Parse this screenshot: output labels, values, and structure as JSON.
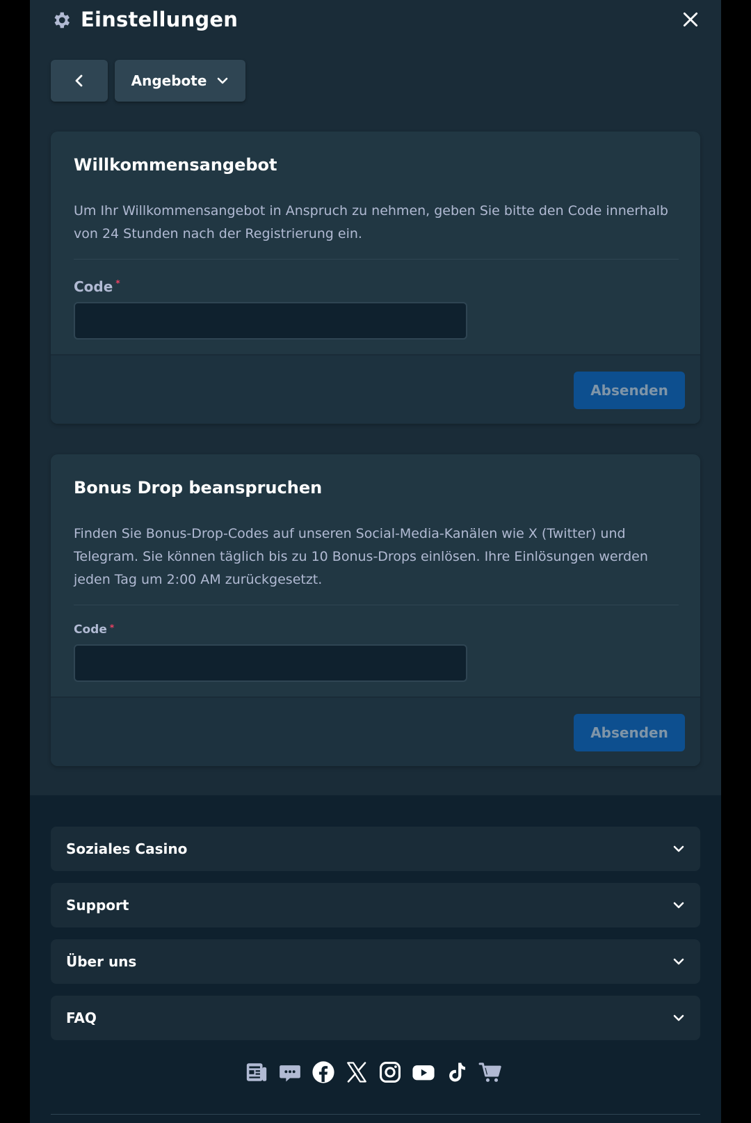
{
  "header": {
    "title": "Einstellungen"
  },
  "nav": {
    "dropdown_label": "Angebote"
  },
  "welcome": {
    "title": "Willkommensangebot",
    "description": "Um Ihr Willkommensangebot in Anspruch zu nehmen, geben Sie bitte den Code innerhalb von 24 Stunden nach der Registrierung ein.",
    "code_label": "Code",
    "required_mark": "*",
    "code_value": "",
    "submit_label": "Absenden"
  },
  "bonus_drop": {
    "title": "Bonus Drop beanspruchen",
    "description": "Finden Sie Bonus-Drop-Codes auf unseren Social-Media-Kanälen wie X (Twitter) und Telegram. Sie können täglich bis zu 10 Bonus-Drops einlösen. Ihre Einlösungen werden jeden Tag um 2:00 AM zurückgesetzt.",
    "code_label": "Code",
    "required_mark": "*",
    "code_value": "",
    "submit_label": "Absenden"
  },
  "footer": {
    "accordions": [
      "Soziales Casino",
      "Support",
      "Über uns",
      "FAQ"
    ],
    "social_icons": [
      "blog-icon",
      "chat-icon",
      "facebook-icon",
      "x-icon",
      "instagram-icon",
      "youtube-icon",
      "tiktok-icon",
      "shop-icon"
    ]
  },
  "colors": {
    "panel_bg": "#1a2c38",
    "card_bg": "#213743",
    "button_bg": "#2f4553",
    "submit_bg": "#0d4f8f",
    "required": "#ed4163",
    "muted_text": "#b1bad3"
  }
}
